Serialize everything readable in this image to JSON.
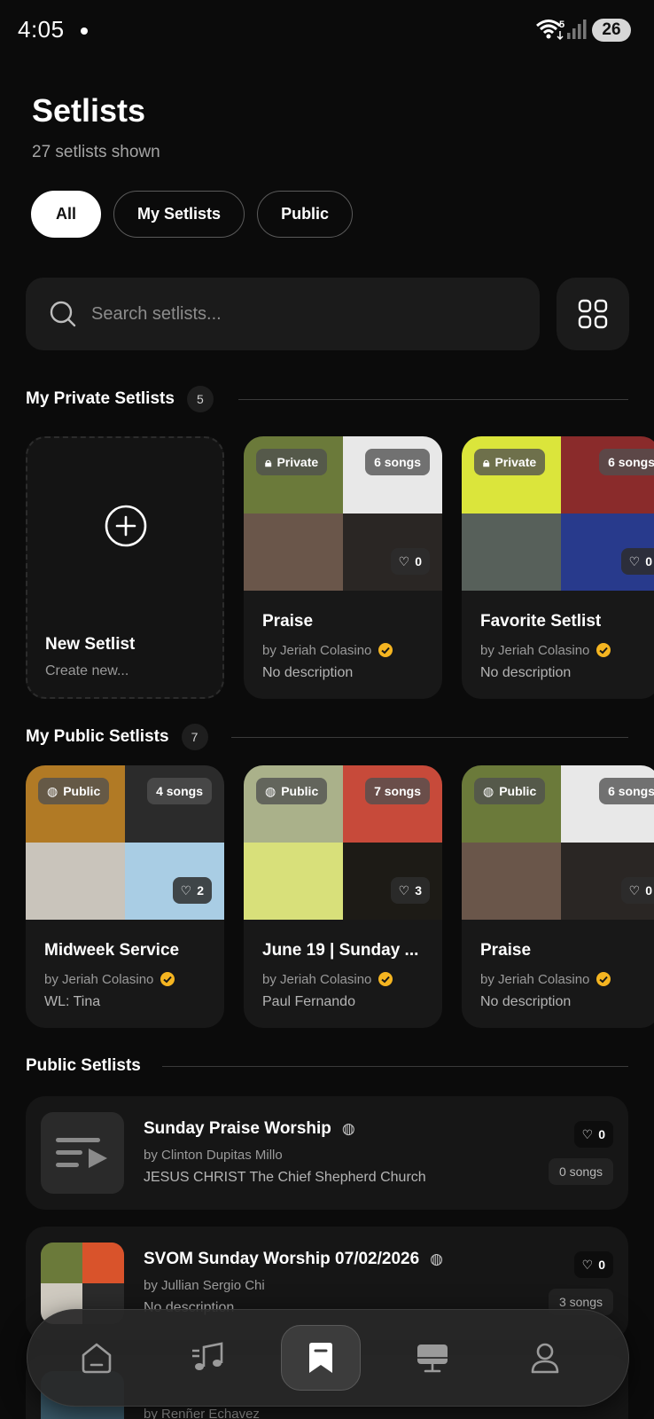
{
  "status_bar": {
    "time": "4:05",
    "wifi_badge": "5",
    "battery": "26"
  },
  "header": {
    "title": "Setlists",
    "subtitle": "27 setlists shown"
  },
  "filters": [
    {
      "label": "All",
      "active": true
    },
    {
      "label": "My Setlists",
      "active": false
    },
    {
      "label": "Public",
      "active": false
    }
  ],
  "search": {
    "placeholder": "Search setlists..."
  },
  "private_section": {
    "title": "My Private Setlists",
    "count": "5",
    "new_card": {
      "title": "New Setlist",
      "subtitle": "Create new..."
    },
    "cards": [
      {
        "visibility": "Private",
        "songs": "6 songs",
        "likes": "0",
        "title": "Praise",
        "author": "by Jeriah Colasino",
        "description": "No description",
        "covers": [
          "#6b7a3a",
          "#e8e8e8",
          "#6a564a",
          "#2a2624"
        ]
      },
      {
        "visibility": "Private",
        "songs": "6 songs",
        "likes": "0",
        "title": "Favorite Setlist",
        "author": "by Jeriah Colasino",
        "description": "No description",
        "covers": [
          "#dbe53b",
          "#8a2b2b",
          "#57605a",
          "#283a8c"
        ]
      }
    ]
  },
  "public_section": {
    "title": "My Public Setlists",
    "count": "7",
    "cards": [
      {
        "visibility": "Public",
        "songs": "4 songs",
        "likes": "2",
        "title": "Midweek Service",
        "author": "by Jeriah Colasino",
        "description": "WL: Tina",
        "covers": [
          "#b17a25",
          "#2b2b2b",
          "#c9c4bb",
          "#a9cde4"
        ]
      },
      {
        "visibility": "Public",
        "songs": "7 songs",
        "likes": "3",
        "title": "June 19 | Sunday ...",
        "author": "by Jeriah Colasino",
        "description": "Paul Fernando",
        "covers": [
          "#aab18a",
          "#c74a3a",
          "#d8e07a",
          "#1d1b16"
        ]
      },
      {
        "visibility": "Public",
        "songs": "6 songs",
        "likes": "0",
        "title": "Praise",
        "author": "by Jeriah Colasino",
        "description": "No description",
        "covers": [
          "#6b7a3a",
          "#e8e8e8",
          "#6a564a",
          "#2a2624"
        ]
      }
    ]
  },
  "public_setlists": {
    "title": "Public Setlists",
    "rows": [
      {
        "title": "Sunday Praise Worship",
        "author": "by Clinton Dupitas Millo",
        "description": "JESUS CHRIST The Chief Shepherd Church",
        "likes": "0",
        "songs": "0 songs"
      },
      {
        "title": "SVOM Sunday Worship 07/02/2026",
        "author": "by Jullian Sergio Chi",
        "description": "No description",
        "likes": "0",
        "songs": "3 songs"
      },
      {
        "title": "",
        "author": "by Renñer Echavez",
        "description": "",
        "likes": "",
        "songs": ""
      }
    ]
  },
  "nav": {
    "items": [
      {
        "name": "home",
        "active": false
      },
      {
        "name": "songs",
        "active": false
      },
      {
        "name": "setlists",
        "active": true
      },
      {
        "name": "presentation",
        "active": false
      },
      {
        "name": "profile",
        "active": false
      }
    ]
  },
  "colors": {
    "background": "#0b0b0b",
    "card": "#181818",
    "verified": "#f5b521",
    "accent": "#ffffff"
  }
}
